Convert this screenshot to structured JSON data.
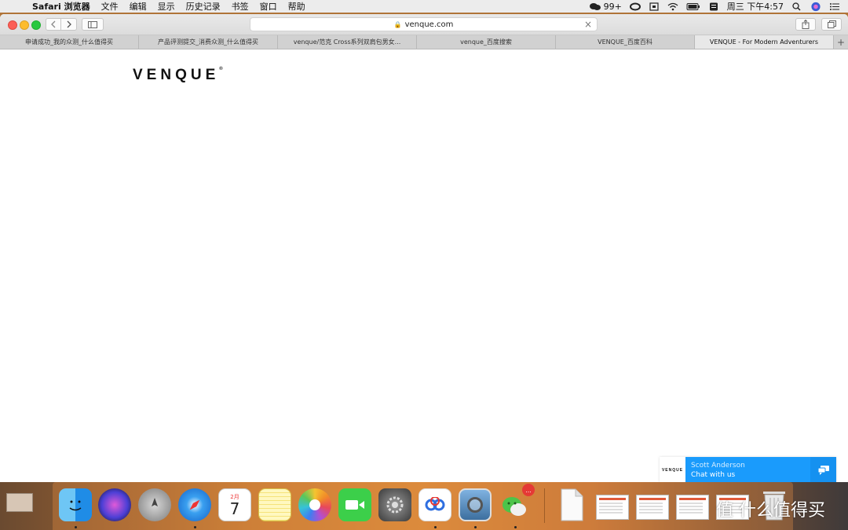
{
  "menubar": {
    "app_name": "Safari 浏览器",
    "items": [
      "文件",
      "编辑",
      "显示",
      "历史记录",
      "书签",
      "窗口",
      "帮助"
    ],
    "wechat_badge": "99+",
    "datetime": "周三 下午4:57"
  },
  "toolbar": {
    "url": "venque.com"
  },
  "tabs": [
    {
      "label": "申请成功_我的众测_什么值得买"
    },
    {
      "label": "产品评测提交_消费众测_什么值得买"
    },
    {
      "label": "venque/范克 Cross系列双肩包男女..."
    },
    {
      "label": "venque_百度搜索"
    },
    {
      "label": "VENQUE_百度百科"
    },
    {
      "label": "VENQUE - For Modern Adventurers"
    }
  ],
  "page": {
    "logo": "VENQUE",
    "chat_logo": "VENQUE",
    "chat_name": "Scott Anderson",
    "chat_cta": "Chat with us"
  },
  "dock": {
    "calendar_month": "2月",
    "calendar_day": "7",
    "wechat_badge": "..."
  },
  "watermark": "值 什么值得买",
  "colors": {
    "chat_bg": "#1a9bfc",
    "close": "#fc5f57",
    "minimize": "#fdbc2e",
    "maximize": "#28c840"
  }
}
